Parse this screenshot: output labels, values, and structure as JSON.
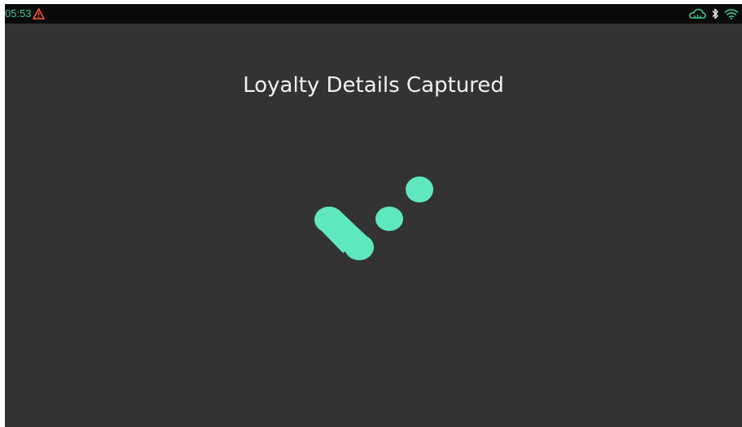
{
  "status_bar": {
    "time": "05:53",
    "left_icons": [
      "warning-icon"
    ],
    "right_icons": [
      "cloud-icon",
      "bluetooth-icon",
      "wifi-icon"
    ]
  },
  "screen": {
    "title": "Loyalty Details Captured"
  },
  "loader": {
    "icon": "loading-dots-icon"
  },
  "colors": {
    "background": "#333333",
    "status_bar": "#0b0b0b",
    "accent": "#5fe8bf",
    "status_time": "#45c79a",
    "warning": "#ff5a3c",
    "title_text": "#f2f2f2"
  }
}
